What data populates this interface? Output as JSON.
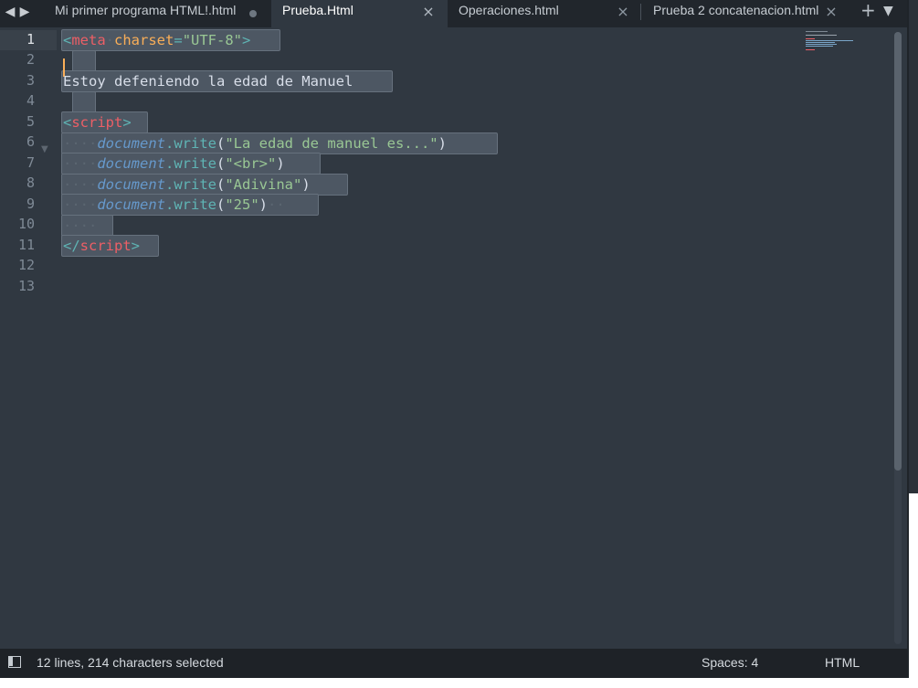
{
  "tabs": [
    {
      "label": "Mi primer programa HTML!.html",
      "state": "dirty"
    },
    {
      "label": "Prueba.Html",
      "state": "active"
    },
    {
      "label": "Operaciones.html",
      "state": "close"
    },
    {
      "label": "Prueba 2 concatenacion.html",
      "state": "close"
    }
  ],
  "tabbar": {
    "close_glyph": "×",
    "plus_glyph": "+",
    "dropdown_glyph": "▼",
    "back_glyph": "◀",
    "forward_glyph": "▶"
  },
  "line_numbers": [
    "1",
    "2",
    "3",
    "4",
    "5",
    "6",
    "7",
    "8",
    "9",
    "10",
    "11",
    "12",
    "13"
  ],
  "code": {
    "l1": {
      "open": "<",
      "tag": "meta",
      "attr": "charset",
      "eq": "=",
      "val": "\"UTF-8\"",
      "close": ">"
    },
    "l3": {
      "text": "Estoy defeniendo la edad de Manuel"
    },
    "l5": {
      "open": "<",
      "tag": "script",
      "close": ">"
    },
    "l6": {
      "obj": "document",
      "dot": ".",
      "fn": "write",
      "p1": "(",
      "str": "\"La edad de manuel es...\"",
      "p2": ")"
    },
    "l7": {
      "obj": "document",
      "dot": ".",
      "fn": "write",
      "p1": "(",
      "str": "\"<br>\"",
      "p2": ")"
    },
    "l8": {
      "obj": "document",
      "dot": ".",
      "fn": "write",
      "p1": "(",
      "str": "\"Adivina\"",
      "p2": ")"
    },
    "l9": {
      "obj": "document",
      "dot": ".",
      "fn": "write",
      "p1": "(",
      "str": "\"25\"",
      "p2": ")"
    },
    "l11": {
      "open": "</",
      "tag": "script",
      "close": ">"
    },
    "indent_dots": "····",
    "trailing_dots": "··"
  },
  "status": {
    "selection": "12 lines, 214 characters selected",
    "indentation": "Spaces: 4",
    "syntax": "HTML"
  },
  "colors": {
    "background": "#303841",
    "tag": "#ec5f66",
    "attribute": "#f9ae58",
    "string": "#99c794",
    "object": "#6699cc",
    "punctuation": "#5fb4b4"
  }
}
